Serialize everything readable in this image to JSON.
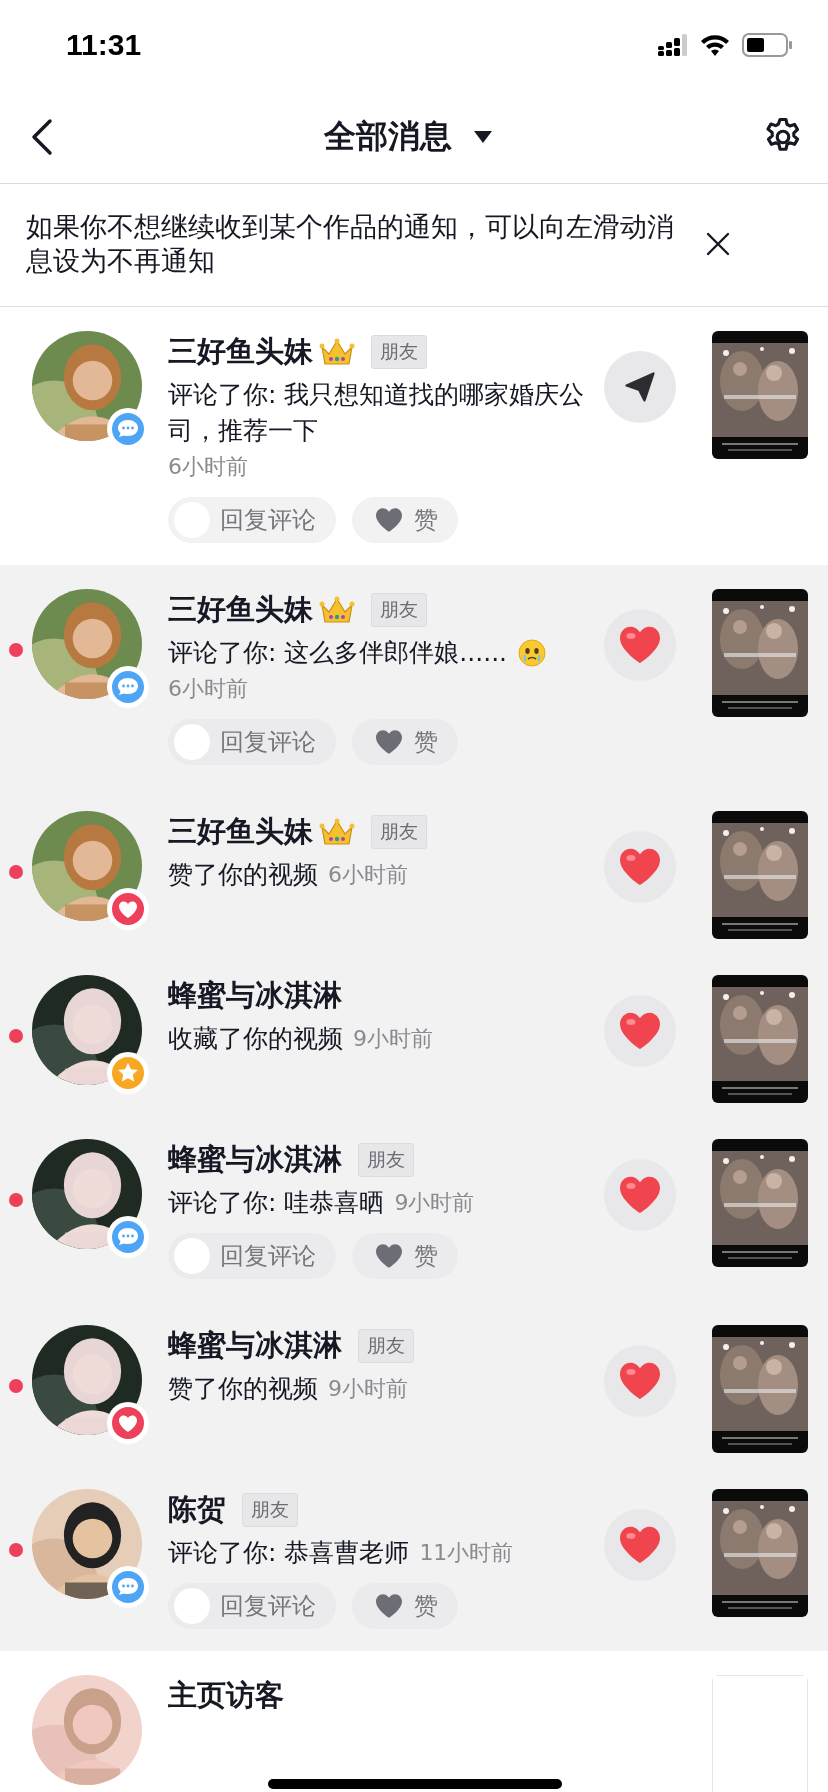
{
  "status_bar": {
    "time": "11:31"
  },
  "nav": {
    "title": "全部消息"
  },
  "banner": {
    "text": "如果你不想继续收到某个作品的通知，可以向左滑动消息设为不再通知"
  },
  "notifications": [
    {
      "kind": "comment",
      "name": "三好鱼头妹",
      "crown": true,
      "tag": "朋友",
      "message": "评论了你: 我只想知道找的哪家婚庆公司，推荐一下",
      "emoji": false,
      "time": "6小时前",
      "unread": false,
      "action": {
        "kind": "send"
      },
      "buttons": [
        {
          "kind": "reply",
          "label": "回复评论"
        },
        {
          "kind": "like",
          "label": "赞"
        }
      ]
    },
    {
      "kind": "comment",
      "name": "三好鱼头妹",
      "crown": true,
      "tag": "朋友",
      "message": "评论了你: 这么多伴郎伴娘......",
      "emoji": true,
      "time": "6小时前",
      "unread": true,
      "action": {
        "kind": "heart"
      },
      "buttons": [
        {
          "kind": "reply",
          "label": "回复评论"
        },
        {
          "kind": "like",
          "label": "赞"
        }
      ]
    },
    {
      "kind": "like",
      "name": "三好鱼头妹",
      "crown": true,
      "tag": "朋友",
      "message": "赞了你的视频",
      "emoji": false,
      "time": "6小时前",
      "unread": true,
      "action": {
        "kind": "heart"
      }
    },
    {
      "kind": "favorite",
      "name": "蜂蜜与冰淇淋",
      "crown": false,
      "message": "收藏了你的视频",
      "emoji": false,
      "time": "9小时前",
      "unread": true,
      "action": {
        "kind": "heart"
      }
    },
    {
      "kind": "comment",
      "name": "蜂蜜与冰淇淋",
      "crown": false,
      "tag": "朋友",
      "message": "评论了你: 哇恭喜晒",
      "emoji": false,
      "time": "9小时前",
      "unread": true,
      "action": {
        "kind": "heart"
      },
      "buttons": [
        {
          "kind": "reply",
          "label": "回复评论"
        },
        {
          "kind": "like",
          "label": "赞"
        }
      ]
    },
    {
      "kind": "like",
      "name": "蜂蜜与冰淇淋",
      "crown": false,
      "tag": "朋友",
      "message": "赞了你的视频",
      "emoji": false,
      "time": "9小时前",
      "unread": true,
      "action": {
        "kind": "heart"
      }
    },
    {
      "kind": "comment",
      "name": "陈贺",
      "crown": false,
      "tag": "朋友",
      "message": "评论了你: 恭喜曹老师",
      "emoji": false,
      "time": "11小时前",
      "unread": true,
      "action": {
        "kind": "heart"
      },
      "buttons": [
        {
          "kind": "reply",
          "label": "回复评论"
        },
        {
          "kind": "like",
          "label": "赞"
        }
      ]
    },
    {
      "kind": "visitor",
      "name": "主页访客",
      "crown": false,
      "unread": false
    }
  ]
}
